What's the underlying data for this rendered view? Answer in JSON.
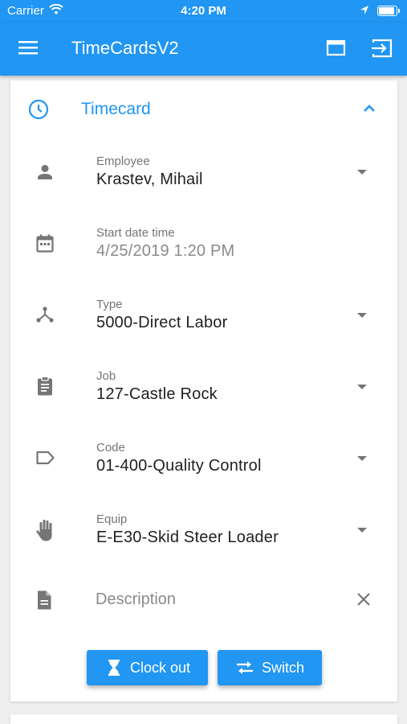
{
  "status_bar": {
    "carrier": "Carrier",
    "time": "4:20 PM"
  },
  "app_bar": {
    "title": "TimeCardsV2"
  },
  "section": {
    "title": "Timecard"
  },
  "fields": {
    "employee": {
      "label": "Employee",
      "value": "Krastev, Mihail"
    },
    "start": {
      "label": "Start date time",
      "value": "4/25/2019 1:20 PM"
    },
    "type": {
      "label": "Type",
      "value": "5000-Direct Labor"
    },
    "job": {
      "label": "Job",
      "value": "127-Castle Rock"
    },
    "code": {
      "label": "Code",
      "value": "01-400-Quality Control"
    },
    "equip": {
      "label": "Equip",
      "value": "E-E30-Skid Steer Loader"
    }
  },
  "description": {
    "placeholder": "Description"
  },
  "actions": {
    "clock_out": "Clock out",
    "switch": "Switch"
  },
  "colors": {
    "primary": "#2196f3",
    "icon_gray": "#757575"
  },
  "icons": [
    "menu-icon",
    "window-icon",
    "exit-icon",
    "clock-icon",
    "chevron-up-icon",
    "person-icon",
    "calendar-icon",
    "type-icon",
    "clipboard-icon",
    "tag-icon",
    "hand-icon",
    "document-icon",
    "close-icon",
    "hourglass-icon",
    "swap-icon"
  ]
}
